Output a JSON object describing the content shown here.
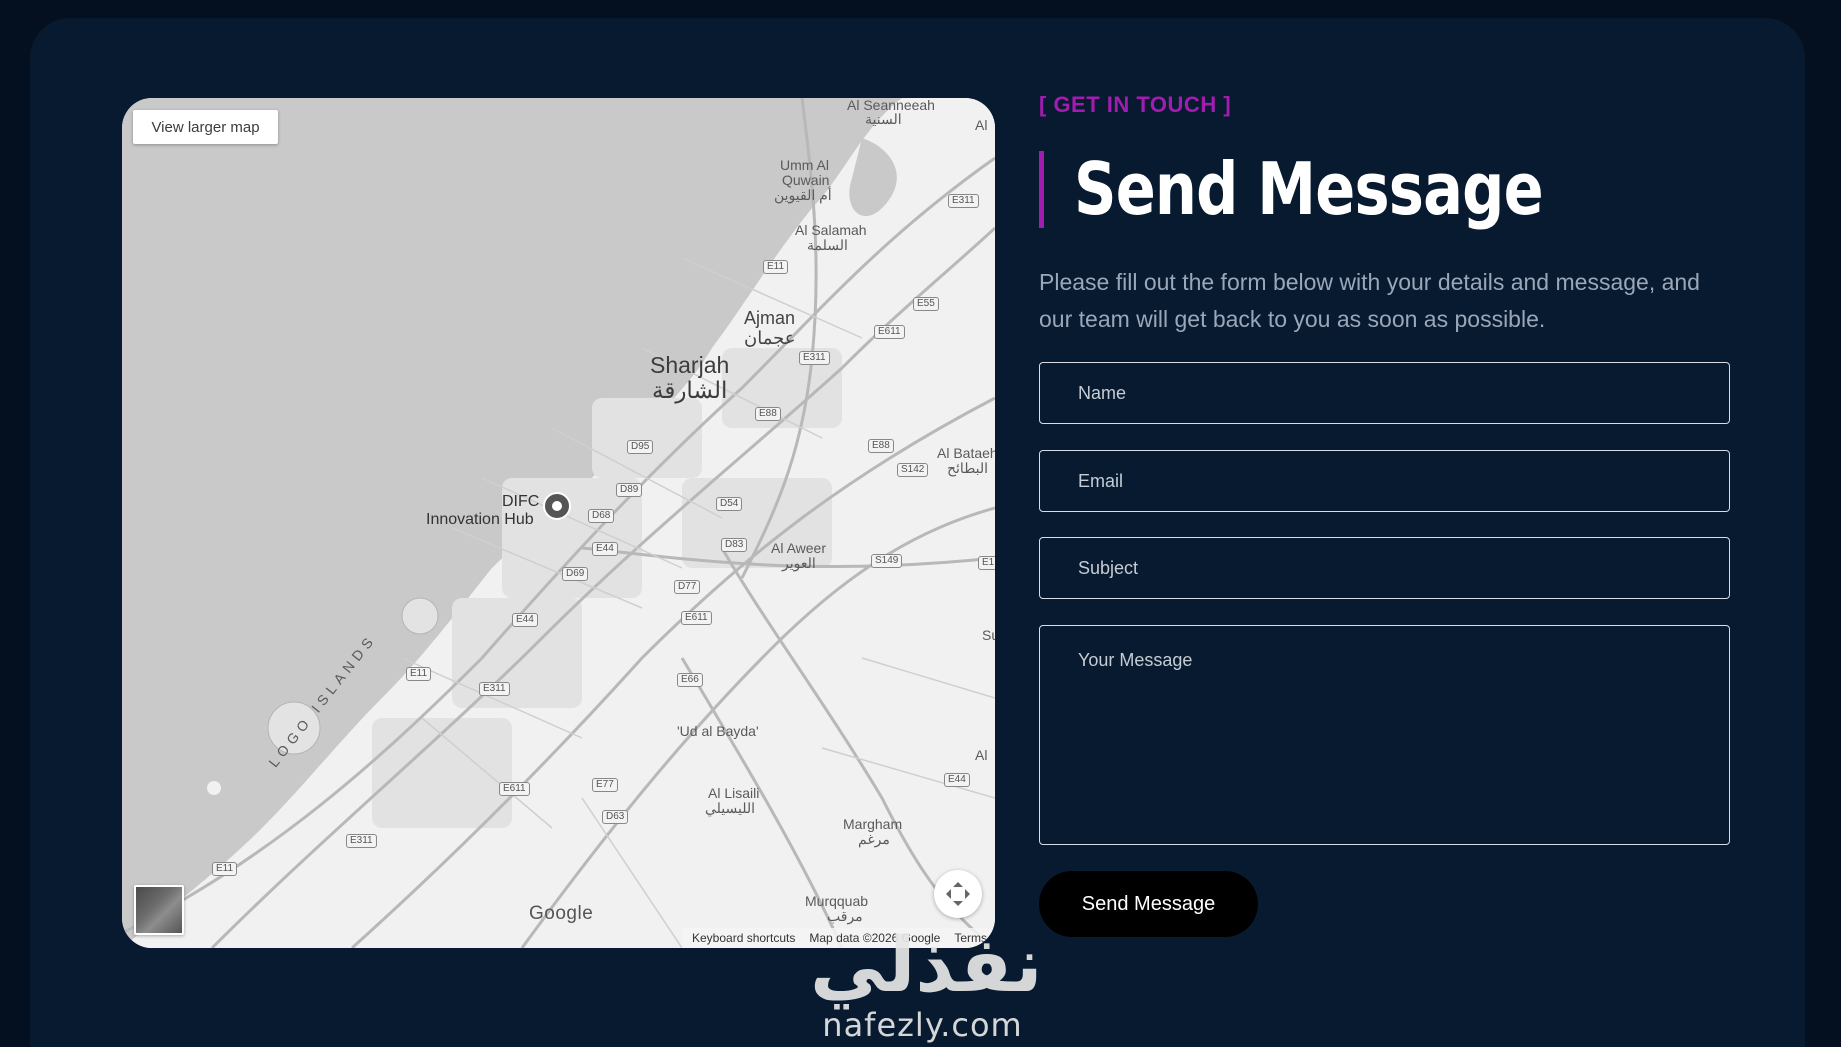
{
  "map": {
    "view_larger_label": "View larger map",
    "pin_label_1": "DIFC",
    "pin_label_2": "Innovation Hub",
    "places": {
      "sharjah": "Sharjah",
      "sharjah_ar": "الشارقة",
      "ajman": "Ajman",
      "ajman_ar": "عجمان",
      "umm_al_quwain_1": "Umm Al",
      "umm_al_quwain_2": "Quwain",
      "umm_al_quwain_ar": "أم القيوين",
      "al_salamah": "Al Salamah",
      "al_salamah_ar": "السلمة",
      "al_seanneeah": "Al Seanneeah",
      "al_seanneeah_ar": "السنية",
      "al_aweer": "Al Aweer",
      "al_aweer_ar": "العوير",
      "al_bataeh": "Al Bataeh",
      "al_bataeh_ar": "البطائح",
      "ud_al_bayda": "'Ud al Bayda'",
      "al_lisaili": "Al Lisaili",
      "al_lisaili_ar": "الليسيلي",
      "margham": "Margham",
      "margham_ar": "مرغم",
      "murqquab": "Murqquab",
      "murqquab_ar": "مرقب",
      "logo_islands": "LOGO ISLANDS",
      "al_right_1": "Al",
      "al_right_2": "Al",
      "su_right": "Su"
    },
    "roads": [
      "E311",
      "E11",
      "E55",
      "E611",
      "E311",
      "E88",
      "E88",
      "S142",
      "D95",
      "D89",
      "D54",
      "D68",
      "E44",
      "D83",
      "D69",
      "D77",
      "S149",
      "E1",
      "E44",
      "E611",
      "E11",
      "E311",
      "E66",
      "E77",
      "D63",
      "E611",
      "E311",
      "E11",
      "E44"
    ],
    "google_logo": "Google",
    "attribution": {
      "shortcuts": "Keyboard shortcuts",
      "map_data": "Map data ©2026 Google",
      "terms": "Terms"
    }
  },
  "form": {
    "eyebrow": "[ GET IN TOUCH ]",
    "title": "Send Message",
    "intro": "Please fill out the form below with your details and message, and our team will get back to you as soon as possible.",
    "name_placeholder": "Name",
    "email_placeholder": "Email",
    "subject_placeholder": "Subject",
    "message_placeholder": "Your Message",
    "submit_label": "Send Message"
  },
  "watermark": {
    "arabic": "نفذلي",
    "latin": "nafezly.com"
  },
  "colors": {
    "page_bg": "#04101f",
    "card_bg": "#081a30",
    "accent": "#a21caf",
    "button_bg": "#000000"
  }
}
